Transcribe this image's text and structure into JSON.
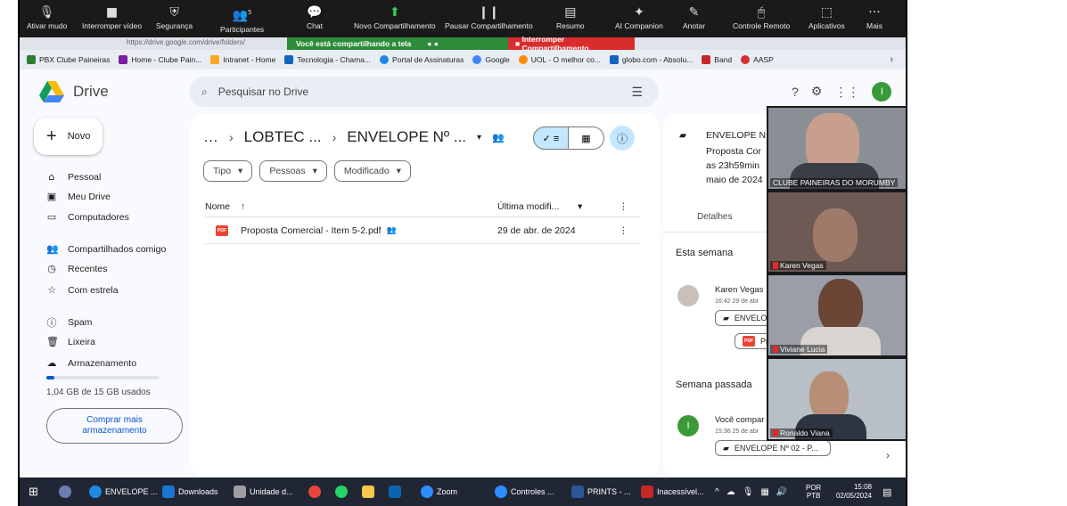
{
  "zoom_toolbar": {
    "items": [
      {
        "label": "Ativar mudo",
        "icon": "microphone-icon"
      },
      {
        "label": "Interromper vídeo",
        "icon": "camera-icon"
      },
      {
        "label": "Segurança",
        "icon": "shield-icon"
      },
      {
        "label": "Participantes",
        "icon": "participants-icon",
        "count": "5"
      },
      {
        "label": "Chat",
        "icon": "chat-icon"
      },
      {
        "label": "Novo Compartilhamento",
        "icon": "share-screen-icon"
      },
      {
        "label": "Pausar Compartilhamento",
        "icon": "pause-icon"
      },
      {
        "label": "Resumo",
        "icon": "summary-icon"
      },
      {
        "label": "AI Companion",
        "icon": "sparkle-icon"
      },
      {
        "label": "Anotar",
        "icon": "pen-icon"
      },
      {
        "label": "Controle Remoto",
        "icon": "remote-icon"
      },
      {
        "label": "Aplicativos",
        "icon": "apps-icon"
      },
      {
        "label": "Mais",
        "icon": "more-icon"
      }
    ]
  },
  "share_banner": {
    "sharing_text": "Você está compartilhando a tela",
    "stop_label": "Interromper Compartilhamento"
  },
  "url_fragment": "https://drive.google.com/drive/folders/",
  "bookmarks": [
    {
      "label": "PBX Clube Paineiras",
      "color": "#2e7d32"
    },
    {
      "label": "Home - Clube Pain...",
      "color": "#7b1fa2"
    },
    {
      "label": "Intranet - Home",
      "color": "#f9a825"
    },
    {
      "label": "Tecnologia - Chama...",
      "color": "#1565c0"
    },
    {
      "label": "Portal de Assinaturas",
      "color": "#1e88e5"
    },
    {
      "label": "Google",
      "color": "#4285f4"
    },
    {
      "label": "UOL - O melhor co...",
      "color": "#fb8c00"
    },
    {
      "label": "globo.com - Absolu...",
      "color": "#1565c0"
    },
    {
      "label": "Band",
      "color": "#c62828"
    },
    {
      "label": "AASP",
      "color": "#d32f2f"
    }
  ],
  "drive": {
    "logo_text": "Drive",
    "search_placeholder": "Pesquisar no Drive",
    "avatar_letter": "I",
    "new_label": "Novo",
    "nav": {
      "pessoal": "Pessoal",
      "meu_drive": "Meu Drive",
      "computadores": "Computadores",
      "compartilhados": "Compartilhados comigo",
      "recentes": "Recentes",
      "com_estrela": "Com estrela",
      "spam": "Spam",
      "lixeira": "Lixeira",
      "armazenamento": "Armazenamento"
    },
    "storage_used_fraction": 0.07,
    "storage_text": "1,04 GB de 15 GB usados",
    "buy_label_1": "Comprar mais",
    "buy_label_2": "armazenamento",
    "breadcrumb": {
      "ellipsis": "…",
      "folder1": "LOBTEC ...",
      "folder2": "ENVELOPE Nº ..."
    },
    "filters": [
      "Tipo",
      "Pessoas",
      "Modificado"
    ],
    "columns": {
      "name": "Nome",
      "modified": "Última modifi..."
    },
    "files": [
      {
        "name": "Proposta Comercial - Item 5-2.pdf",
        "modified": "29 de abr. de 2024",
        "type": "PDF"
      }
    ]
  },
  "details": {
    "title": "ENVELOPE N",
    "desc_1": "Proposta Cor",
    "desc_2": "as 23h59min",
    "desc_3": "maio de 2024",
    "tab_details": "Detalhes",
    "this_week": "Esta semana",
    "activity1_user": "Karen Vegas",
    "activity1_time": "16:42 29 de abr",
    "activity1_folder": "ENVELO",
    "activity1_file": "Pro",
    "last_week": "Semana passada",
    "activity2_user": "Você compar",
    "activity2_time": "15:36 25 de abr",
    "activity2_folder": "ENVELOPE Nº 02 - P...",
    "avatar2_letter": "I"
  },
  "participants": [
    {
      "name": "CLUBE PAINEIRAS DO MORUMBY",
      "bg": "#8a8f96"
    },
    {
      "name": "Karen Vegas",
      "bg": "#7a6560"
    },
    {
      "name": "Viviane Lucia",
      "bg": "#9a9ea8"
    },
    {
      "name": "Ronaldo Viana",
      "bg": "#b8bfc7"
    }
  ],
  "taskbar": {
    "items": [
      {
        "label": "ENVELOPE ...",
        "color": "#1e88e5"
      },
      {
        "label": "Downloads",
        "color": "#1976d2"
      },
      {
        "label": "Unidade d...",
        "color": "#9e9e9e"
      },
      {
        "label": "Zoom",
        "color": "#2d8cff"
      },
      {
        "label": "Controles ...",
        "color": "#2d8cff"
      },
      {
        "label": "PRINTS - ...",
        "color": "#2b579a"
      },
      {
        "label": "Inacessível...",
        "color": "#c62828"
      }
    ],
    "lang_1": "POR",
    "lang_2": "PTB",
    "time": "15:08",
    "date": "02/05/2024"
  }
}
